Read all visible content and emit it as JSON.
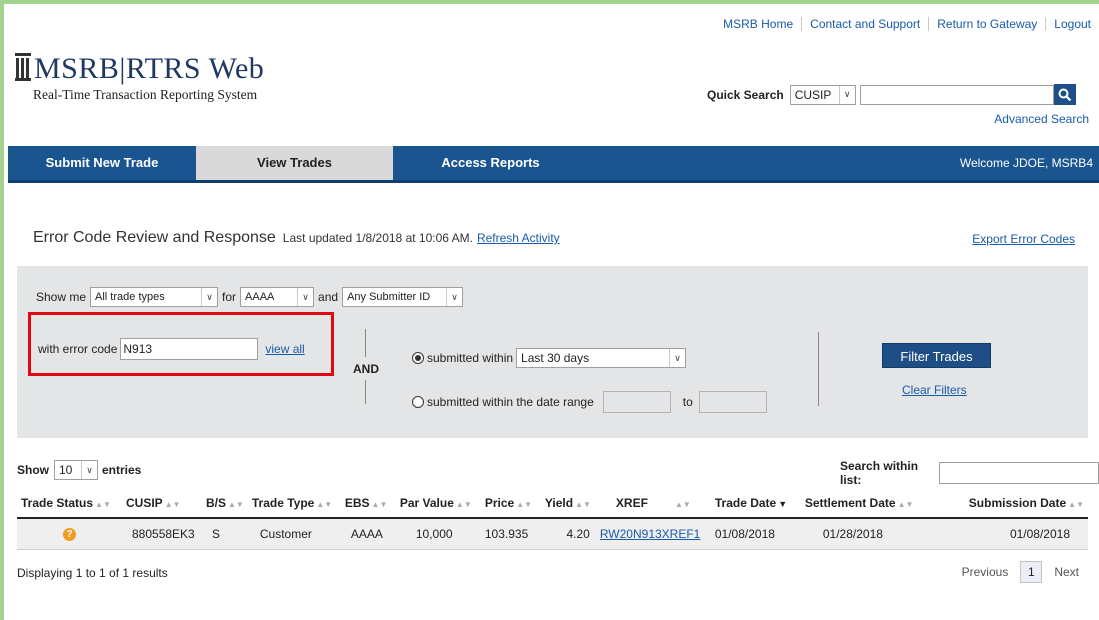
{
  "top_links": [
    "MSRB Home",
    "Contact and Support",
    "Return to Gateway",
    "Logout"
  ],
  "logo": {
    "title": "MSRB|RTRS Web",
    "subtitle": "Real-Time Transaction Reporting System"
  },
  "quick_search": {
    "label": "Quick Search",
    "type": "CUSIP",
    "value": "",
    "advanced": "Advanced Search"
  },
  "nav": {
    "tabs": [
      "Submit New Trade",
      "View Trades",
      "Access Reports"
    ],
    "active": "View Trades",
    "welcome": "Welcome JDOE, MSRB4"
  },
  "page": {
    "title": "Error Code Review and Response",
    "updated": "Last updated 1/8/2018 at 10:06 AM.",
    "refresh": "Refresh Activity",
    "export": "Export Error Codes"
  },
  "filters": {
    "show_me_label": "Show me",
    "trade_types": "All trade types",
    "for_label": "for",
    "for_value": "AAAA",
    "and_label": "and",
    "submitter": "Any Submitter ID",
    "error_code_label": "with error code",
    "error_code_value": "N913",
    "view_all": "view all",
    "and_separator": "AND",
    "submitted_within_label": "submitted within",
    "submitted_within_value": "Last 30 days",
    "date_range_label": "submitted within the date range",
    "to_label": "to",
    "filter_button": "Filter Trades",
    "clear_filters": "Clear Filters"
  },
  "table_controls": {
    "show_label": "Show",
    "entries_value": "10",
    "entries_label": "entries",
    "search_label": "Search within list:"
  },
  "table": {
    "columns": [
      "Trade Status",
      "CUSIP",
      "B/S",
      "Trade Type",
      "EBS",
      "Par Value",
      "Price",
      "Yield",
      "XREF",
      "Trade Date",
      "Settlement Date",
      "Submission Date"
    ],
    "rows": [
      {
        "status_icon": "?",
        "cusip": "880558EK3",
        "bs": "S",
        "trade_type": "Customer",
        "ebs": "AAAA",
        "par_value": "10,000",
        "price": "103.935",
        "yield": "4.20",
        "xref": "RW20N913XREF1",
        "trade_date": "01/08/2018",
        "settlement_date": "01/28/2018",
        "submission_date": "01/08/2018"
      }
    ]
  },
  "footer": {
    "displaying": "Displaying 1 to 1 of 1 results",
    "previous": "Previous",
    "page": "1",
    "next": "Next"
  },
  "colors": {
    "nav": "#1b5590",
    "accent_red": "#e30613",
    "status_pending": "#f29c1f",
    "frame": "#a3d38c"
  }
}
